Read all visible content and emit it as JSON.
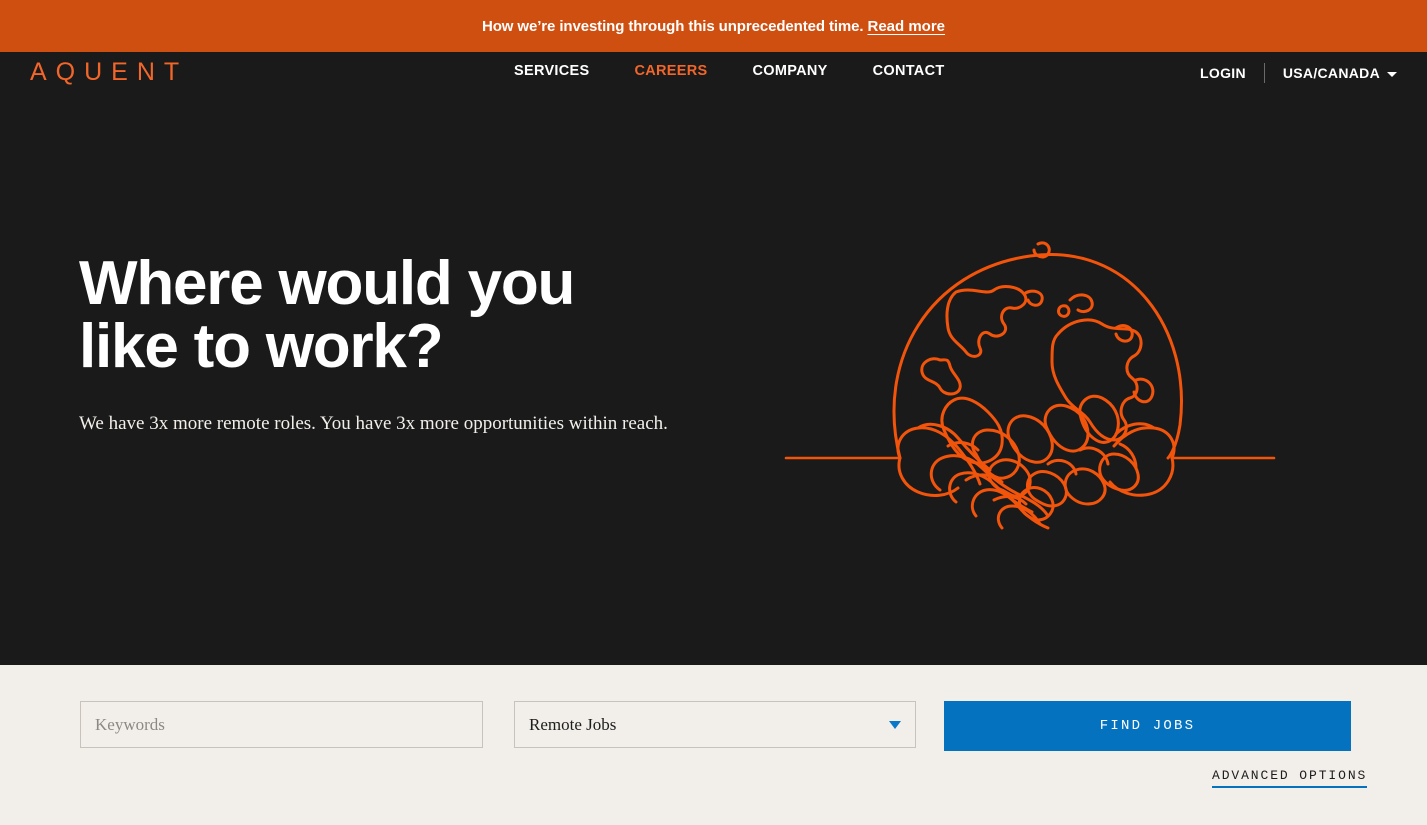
{
  "announcement": {
    "text": "How we’re investing through this unprecedented time.",
    "link_label": "Read more",
    "bg_color": "#CF4F10"
  },
  "nav": {
    "logo": "AQUENT",
    "items": [
      {
        "label": "SERVICES",
        "active": false
      },
      {
        "label": "CAREERS",
        "active": true
      },
      {
        "label": "COMPANY",
        "active": false
      },
      {
        "label": "CONTACT",
        "active": false
      }
    ],
    "login_label": "LOGIN",
    "region_label": "USA/CANADA",
    "active_color": "#F2662A"
  },
  "hero": {
    "title_line1": "Where would you",
    "title_line2": "like to work?",
    "subtitle": "We have 3x more remote roles. You have 3x more opportunities within reach.",
    "illustration_name": "globe-handshake-line-art",
    "illustration_color": "#F2540B",
    "background_color": "#1A1A1A"
  },
  "search": {
    "keywords_placeholder": "Keywords",
    "keywords_value": "",
    "job_type_selected": "Remote Jobs",
    "job_type_options": [
      "Remote Jobs"
    ],
    "find_jobs_label": "FIND JOBS",
    "advanced_options_label": "ADVANCED OPTIONS",
    "button_color": "#0572C0",
    "section_bg": "#F2EFEA"
  }
}
